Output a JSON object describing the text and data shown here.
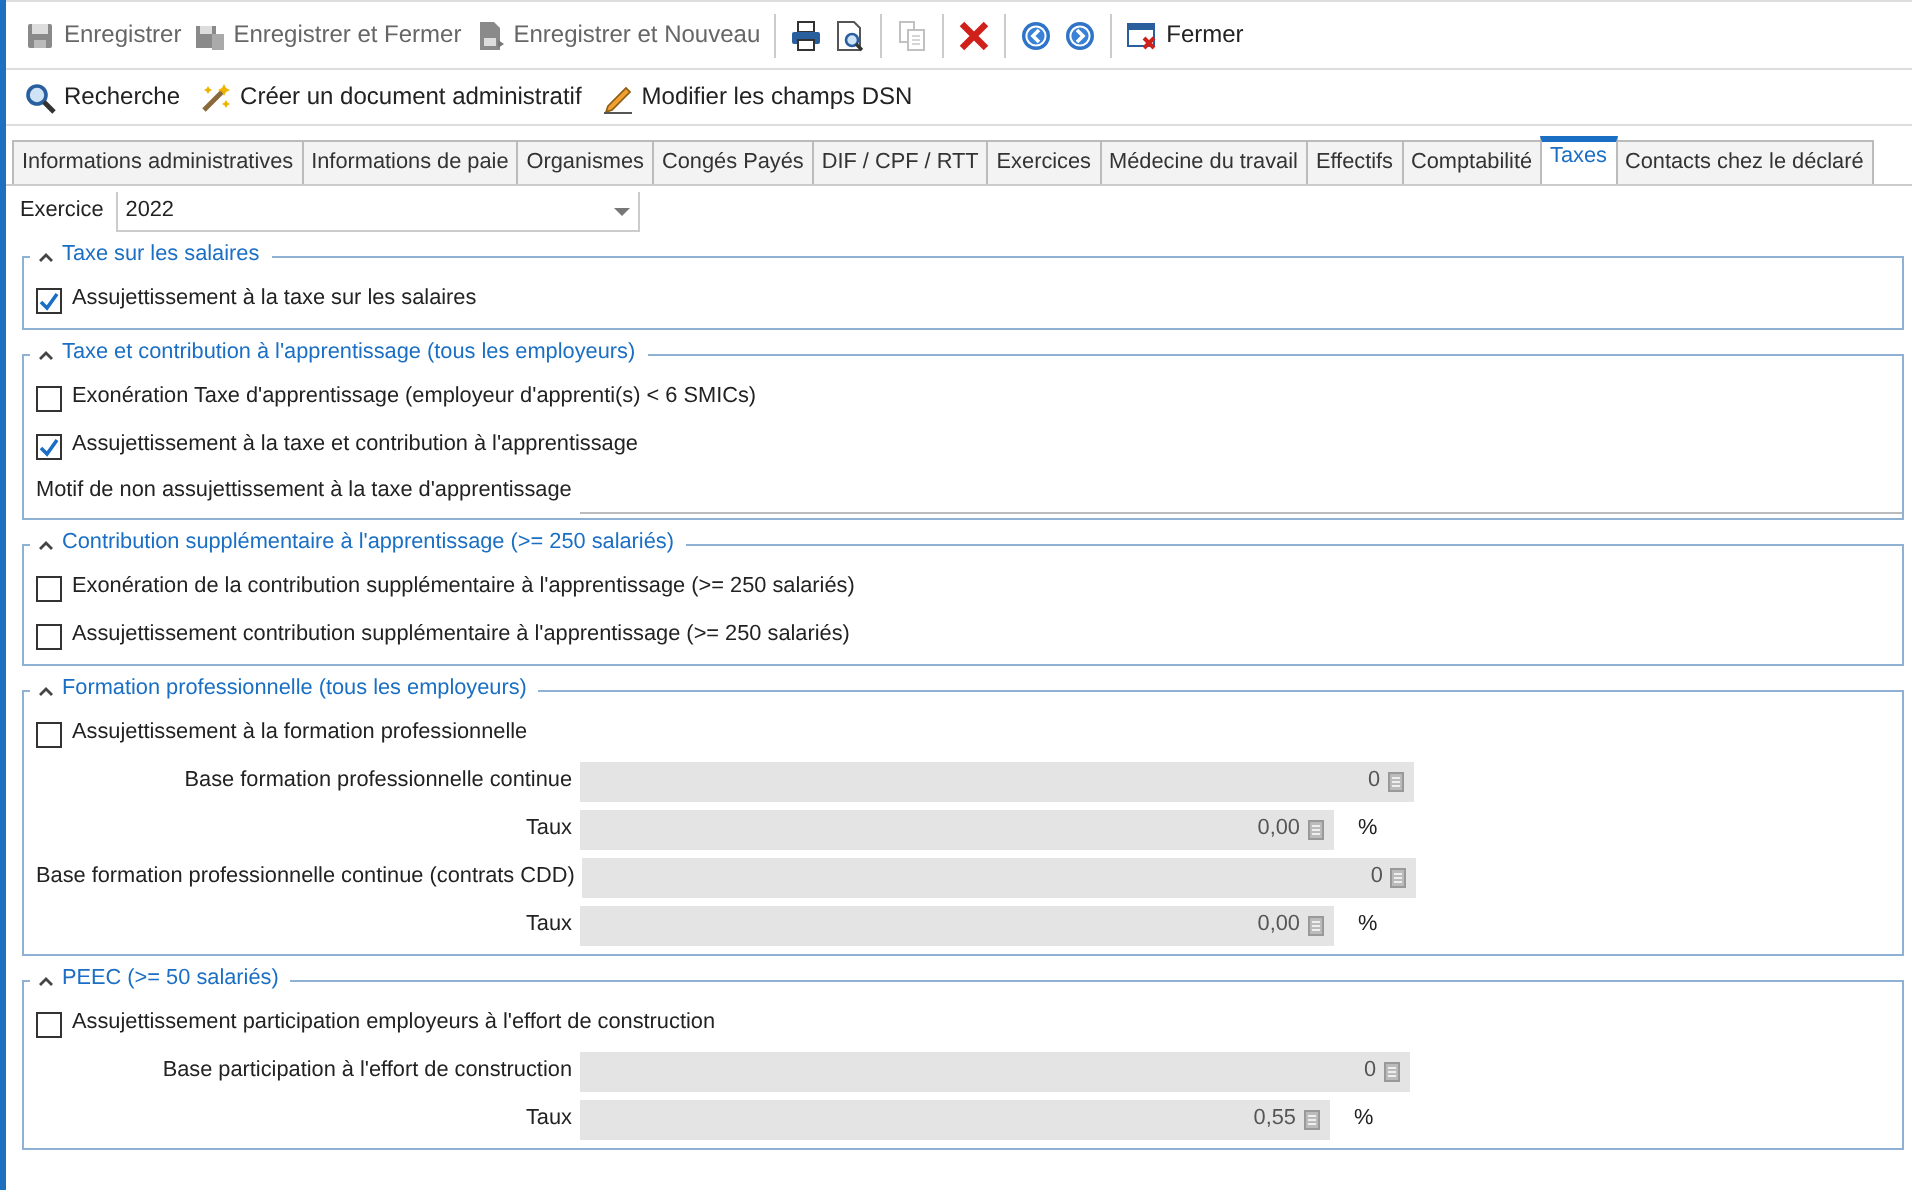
{
  "toolbar": {
    "groups": [
      [
        {
          "label": "Enregistrer",
          "disabled": true
        },
        {
          "label": "Enregistrer et Fermer",
          "disabled": true
        },
        {
          "label": "Enregistrer et Nouveau",
          "disabled": true
        }
      ],
      [
        {
          "disabled": false
        },
        {
          "disabled": false
        }
      ],
      [
        {
          "disabled": true
        }
      ],
      [
        {
          "disabled": false
        }
      ],
      [
        {
          "disabled": false
        },
        {
          "disabled": false
        }
      ],
      [
        {
          "label": "Fermer",
          "disabled": false
        }
      ]
    ]
  },
  "actions": [
    {
      "label": "Recherche"
    },
    {
      "label": "Créer un document administratif"
    },
    {
      "label": "Modifier les champs DSN"
    }
  ],
  "tabs": [
    {
      "label": "Informations administratives",
      "selected": false
    },
    {
      "label": "Informations de paie",
      "selected": false
    },
    {
      "label": "Organismes",
      "selected": false
    },
    {
      "label": "Congés Payés",
      "selected": false
    },
    {
      "label": "DIF / CPF / RTT",
      "selected": false
    },
    {
      "label": "Exercices",
      "selected": false
    },
    {
      "label": "Médecine du travail",
      "selected": false
    },
    {
      "label": "Effectifs",
      "selected": false
    },
    {
      "label": "Comptabilité",
      "selected": false
    },
    {
      "label": "Taxes",
      "selected": true
    },
    {
      "label": "Contacts chez le déclaré",
      "selected": false
    }
  ],
  "exercice": {
    "label": "Exercice",
    "value": "2022"
  },
  "sections": [
    {
      "title": "Taxe sur les salaires",
      "expanded": true,
      "rows": [
        {
          "kind": "checkbox",
          "label": "Assujettissement à la taxe sur les salaires",
          "checked": true
        }
      ]
    },
    {
      "title": "Taxe et contribution à l'apprentissage (tous les employeurs)",
      "expanded": true,
      "rows": [
        {
          "kind": "checkbox",
          "label": "Exonération Taxe d'apprentissage (employeur d'apprenti(s) < 6 SMICs)",
          "checked": false
        },
        {
          "kind": "checkbox",
          "label": "Assujettissement à la taxe et contribution à l'apprentissage",
          "checked": true
        },
        {
          "kind": "text",
          "label": "Motif de non assujettissement à la taxe d'apprentissage"
        }
      ]
    },
    {
      "title": "Contribution supplémentaire à l'apprentissage (>= 250 salariés)",
      "expanded": true,
      "rows": [
        {
          "kind": "checkbox",
          "label": "Exonération de la contribution supplémentaire à l'apprentissage (>= 250 salariés)",
          "checked": false
        },
        {
          "kind": "checkbox",
          "label": "Assujettissement contribution supplémentaire à l'apprentissage (>= 250 salariés)",
          "checked": false
        }
      ]
    },
    {
      "title": "Formation professionnelle (tous les employeurs)",
      "expanded": true,
      "rows": [
        {
          "kind": "checkbox",
          "label": "Assujettissement à la formation professionnelle",
          "checked": false
        },
        {
          "kind": "number",
          "label": "Base formation professionnelle continue",
          "value": "0",
          "disabled": true
        },
        {
          "kind": "number",
          "label": "Taux",
          "value": "0,00",
          "unit": "%",
          "disabled": true
        },
        {
          "kind": "number",
          "label": "Base formation professionnelle continue (contrats CDD)",
          "value": "0",
          "disabled": true
        },
        {
          "kind": "number",
          "label": "Taux",
          "value": "0,00",
          "unit": "%",
          "disabled": true
        }
      ]
    },
    {
      "title": "PEEC (>= 50 salariés)",
      "expanded": true,
      "rows": [
        {
          "kind": "checkbox",
          "label": "Assujettissement participation employeurs à l'effort de construction",
          "checked": false
        },
        {
          "kind": "number",
          "label": "Base participation à l'effort de construction",
          "value": "0",
          "disabled": true
        },
        {
          "kind": "number",
          "label": "Taux",
          "value": "0,55",
          "unit": "%",
          "disabled": true
        }
      ]
    }
  ]
}
